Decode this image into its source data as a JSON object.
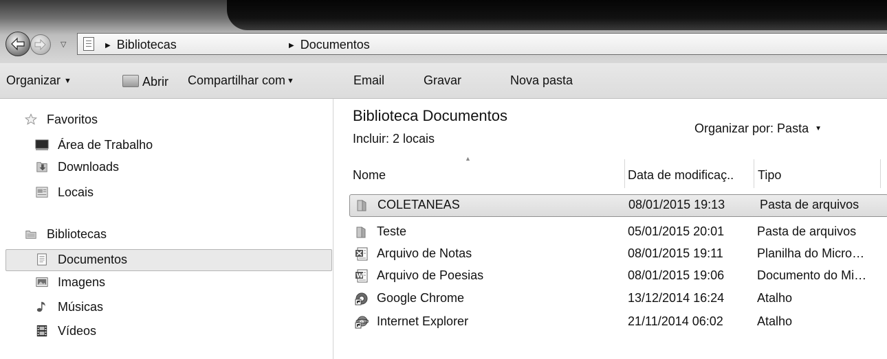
{
  "address_bar": {
    "crumbs": [
      "Bibliotecas",
      "Documentos"
    ]
  },
  "toolbar": {
    "organize": "Organizar",
    "open": "Abrir",
    "share": "Compartilhar com",
    "email": "Email",
    "burn": "Gravar",
    "new_folder": "Nova pasta"
  },
  "sidebar": {
    "favorites": {
      "header": "Favoritos",
      "items": [
        {
          "label": "Área de Trabalho",
          "icon": "desktop-icon"
        },
        {
          "label": "Downloads",
          "icon": "downloads-icon"
        },
        {
          "label": "Locais",
          "icon": "recent-places-icon"
        }
      ]
    },
    "libraries": {
      "header": "Bibliotecas",
      "items": [
        {
          "label": "Documentos",
          "icon": "documents-icon",
          "selected": true
        },
        {
          "label": "Imagens",
          "icon": "pictures-icon"
        },
        {
          "label": "Músicas",
          "icon": "music-icon"
        },
        {
          "label": "Vídeos",
          "icon": "videos-icon"
        }
      ]
    }
  },
  "main": {
    "title": "Biblioteca Documentos",
    "subtitle": "Incluir: 2 locais",
    "arrange_by": "Organizar por: Pasta",
    "columns": {
      "name": "Nome",
      "date": "Data de modificaç..",
      "type": "Tipo"
    },
    "files": [
      {
        "name": "COLETANEAS",
        "date": "08/01/2015 19:13",
        "type": "Pasta de arquivos",
        "icon": "folder-icon",
        "selected": true
      },
      {
        "name": "Teste",
        "date": "05/01/2015 20:01",
        "type": "Pasta de arquivos",
        "icon": "folder-icon"
      },
      {
        "name": "Arquivo de Notas",
        "date": "08/01/2015 19:11",
        "type": "Planilha do Micro…",
        "icon": "excel-file-icon"
      },
      {
        "name": "Arquivo de Poesias",
        "date": "08/01/2015 19:06",
        "type": "Documento do Mi…",
        "icon": "word-file-icon"
      },
      {
        "name": "Google Chrome",
        "date": "13/12/2014 16:24",
        "type": "Atalho",
        "icon": "chrome-shortcut-icon"
      },
      {
        "name": "Internet Explorer",
        "date": "21/11/2014 06:02",
        "type": "Atalho",
        "icon": "ie-shortcut-icon"
      }
    ]
  }
}
